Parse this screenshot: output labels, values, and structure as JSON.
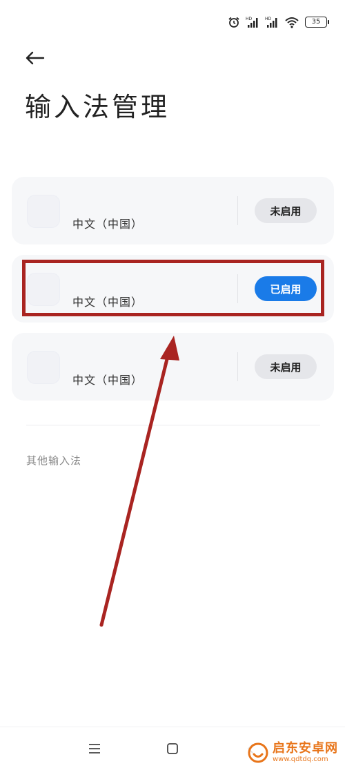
{
  "status_bar": {
    "battery": "35",
    "icons": [
      "alarm-icon",
      "hd-signal-icon",
      "hd-signal-icon",
      "wifi-icon",
      "battery-icon"
    ]
  },
  "header": {
    "back_icon": "arrow-left-icon",
    "title": "输入法管理"
  },
  "input_methods": [
    {
      "sub_label": "中文（中国）",
      "status": "未启用",
      "enabled": false
    },
    {
      "sub_label": "中文（中国）",
      "status": "已启用",
      "enabled": true
    },
    {
      "sub_label": "中文（中国）",
      "status": "未启用",
      "enabled": false
    }
  ],
  "other_section": {
    "label": "其他输入法"
  },
  "nav_bar": {
    "icons": [
      "menu-icon",
      "home-icon",
      "back-icon"
    ]
  },
  "annotation": {
    "colors": {
      "highlight": "#a92421"
    }
  },
  "watermark": {
    "title": "启东安卓网",
    "url": "www.qdtdq.com"
  },
  "colors": {
    "accent": "#1a7be8",
    "card_bg": "#f6f7f9",
    "pill_off_bg": "#e5e6ea"
  }
}
